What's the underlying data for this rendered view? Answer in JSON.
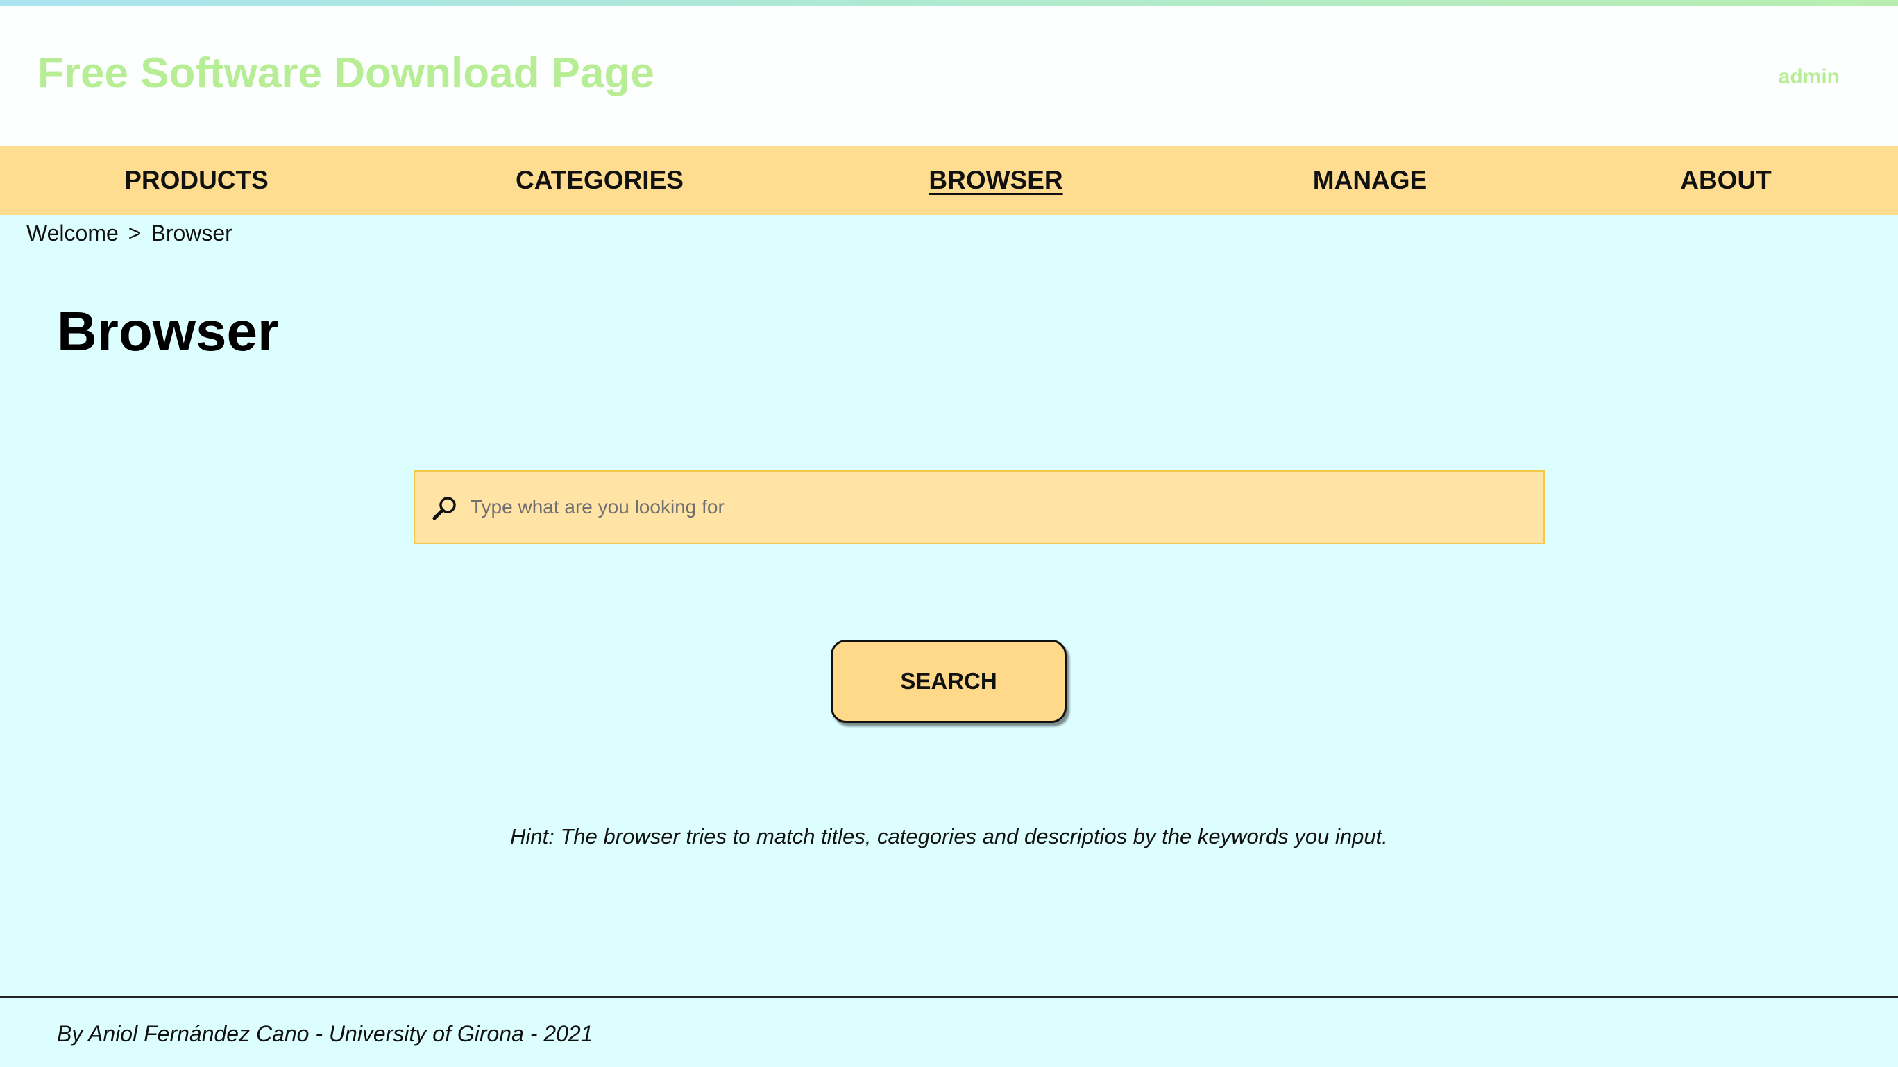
{
  "header": {
    "title": "Free Software Download Page",
    "user": "admin"
  },
  "nav": {
    "items": [
      {
        "label": "PRODUCTS"
      },
      {
        "label": "CATEGORIES"
      },
      {
        "label": "BROWSER",
        "active": true
      },
      {
        "label": "MANAGE"
      },
      {
        "label": "ABOUT"
      }
    ]
  },
  "breadcrumb": {
    "items": [
      "Welcome",
      "Browser"
    ],
    "separator": ">"
  },
  "main": {
    "title": "Browser",
    "search": {
      "placeholder": "Type what are you looking for",
      "value": "",
      "icon": "search-icon"
    },
    "search_button": "SEARCH",
    "hint": "Hint: The browser tries to match titles, categories and descriptios by the keywords you input."
  },
  "footer": {
    "text": "By Aniol Fernández Cano - University of Girona - 2021"
  },
  "colors": {
    "background": "#ddfeff",
    "nav": "#ffdd90",
    "title_accent": "#b7ee95",
    "search_field": "#ffe4a6",
    "button": "#ffd98a"
  }
}
